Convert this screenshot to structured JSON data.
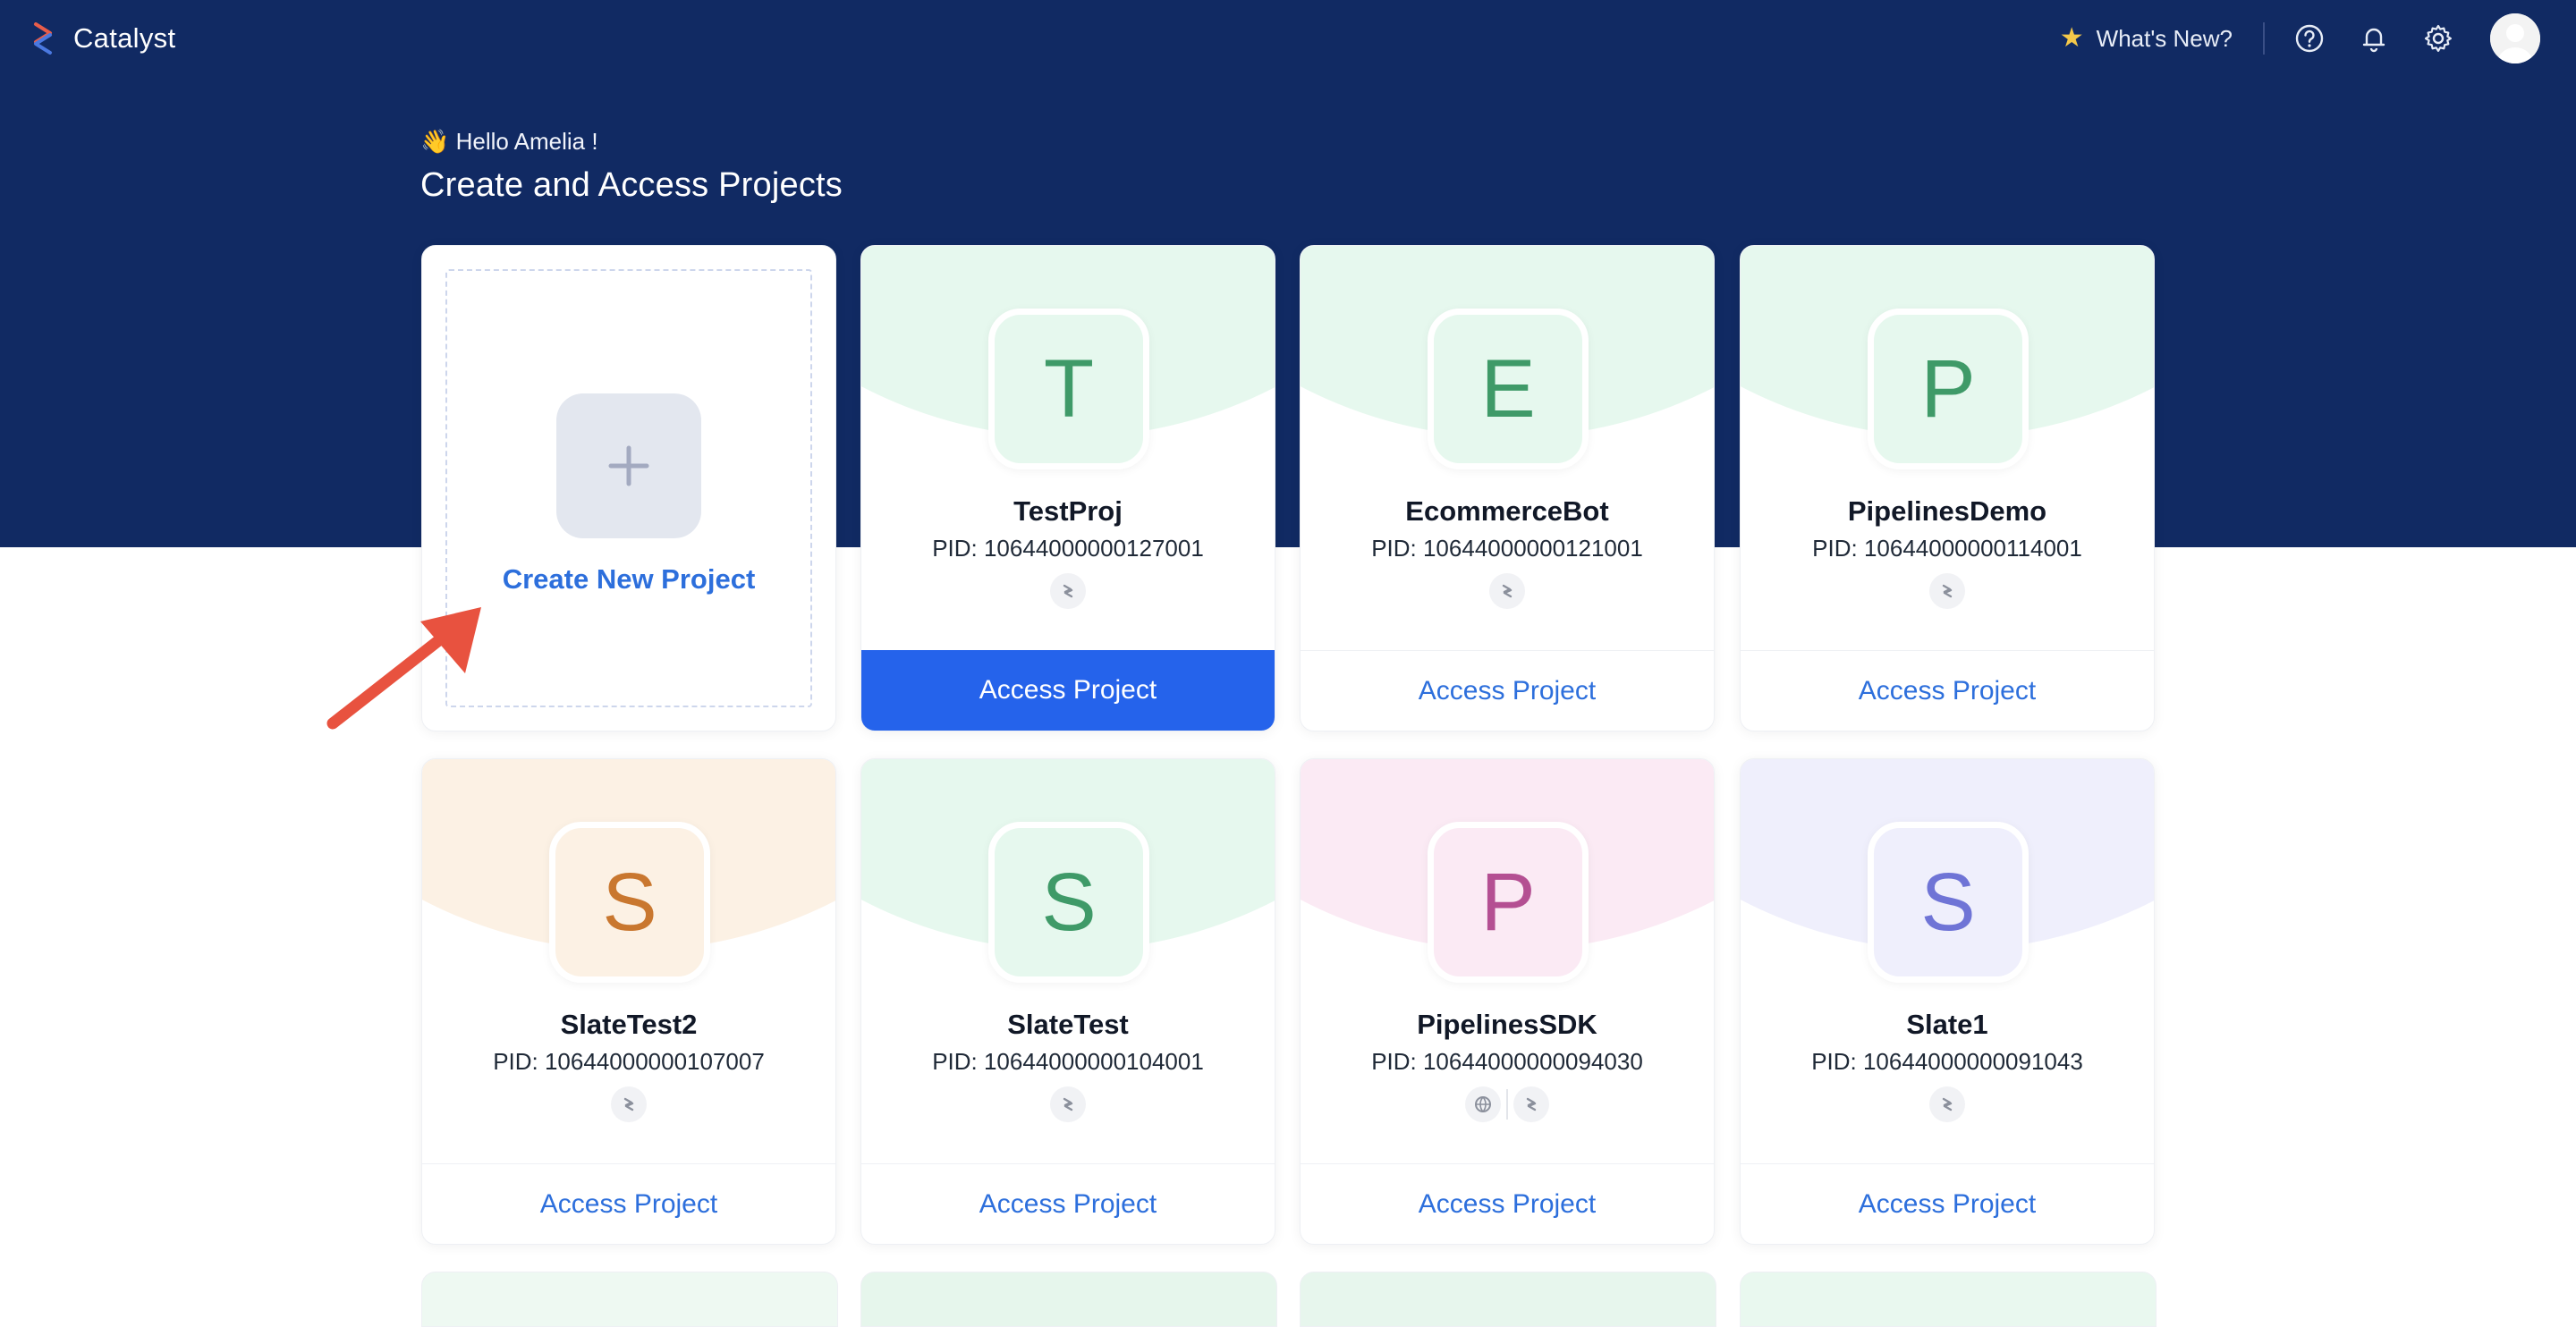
{
  "app": {
    "name": "Catalyst"
  },
  "topbar": {
    "whats_new": "What's New?",
    "icons": [
      "help-icon",
      "bell-icon",
      "gear-icon",
      "avatar"
    ]
  },
  "hero": {
    "greeting": "👋 Hello Amelia !",
    "title": "Create and Access Projects"
  },
  "create_card": {
    "label": "Create New Project"
  },
  "projects": [
    {
      "initial": "T",
      "name": "TestProj",
      "pid": "PID: 10644000000127001",
      "access": "Access Project",
      "accent": "#3f9a68",
      "bg": "#e6f8ee",
      "icons": [
        "slate-icon"
      ]
    },
    {
      "initial": "E",
      "name": "EcommerceBot",
      "pid": "PID: 10644000000121001",
      "access": "Access Project",
      "accent": "#3f9a68",
      "bg": "#e6f8ee",
      "icons": [
        "slate-icon"
      ]
    },
    {
      "initial": "P",
      "name": "PipelinesDemo",
      "pid": "PID: 10644000000114001",
      "access": "Access Project",
      "accent": "#3f9a68",
      "bg": "#e6f8ee",
      "icons": [
        "slate-icon"
      ]
    },
    {
      "initial": "S",
      "name": "SlateTest2",
      "pid": "PID: 10644000000107007",
      "access": "Access Project",
      "accent": "#c9772f",
      "bg": "#fcf1e4",
      "icons": [
        "slate-icon"
      ]
    },
    {
      "initial": "S",
      "name": "SlateTest",
      "pid": "PID: 10644000000104001",
      "access": "Access Project",
      "accent": "#3f9a68",
      "bg": "#e6f8ee",
      "icons": [
        "slate-icon"
      ]
    },
    {
      "initial": "P",
      "name": "PipelinesSDK",
      "pid": "PID: 10644000000094030",
      "access": "Access Project",
      "accent": "#b44f92",
      "bg": "#fbeaf4",
      "icons": [
        "globe-icon",
        "slate-icon"
      ]
    },
    {
      "initial": "S",
      "name": "Slate1",
      "pid": "PID: 10644000000091043",
      "access": "Access Project",
      "accent": "#6f74d6",
      "bg": "#efeffc",
      "icons": [
        "slate-icon"
      ]
    }
  ],
  "colors": {
    "header_bg": "#112a63",
    "primary": "#2563eb",
    "link": "#2d6fdc"
  }
}
